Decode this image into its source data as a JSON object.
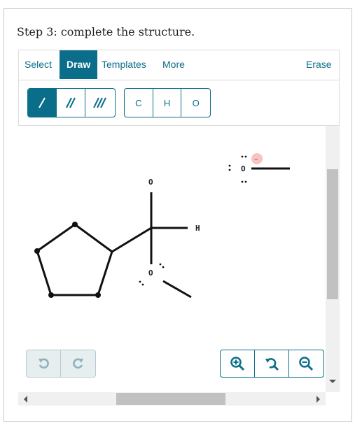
{
  "prompt": "Step 3: complete the structure.",
  "toolbar": {
    "select_label": "Select",
    "draw_label": "Draw",
    "templates_label": "Templates",
    "more_label": "More",
    "erase_label": "Erase"
  },
  "bond_tools": [
    "single-bond",
    "double-bond",
    "triple-bond"
  ],
  "atom_tools": [
    "C",
    "H",
    "O"
  ],
  "molecule": {
    "atom_o_top": "O",
    "atom_h": "H",
    "atom_o_mid": "O",
    "atom_o_ion": "O",
    "charge": "–"
  },
  "colors": {
    "accent": "#0a6e8a",
    "charge_bg": "#f7c3c3",
    "charge_fg": "#d32f2f"
  }
}
